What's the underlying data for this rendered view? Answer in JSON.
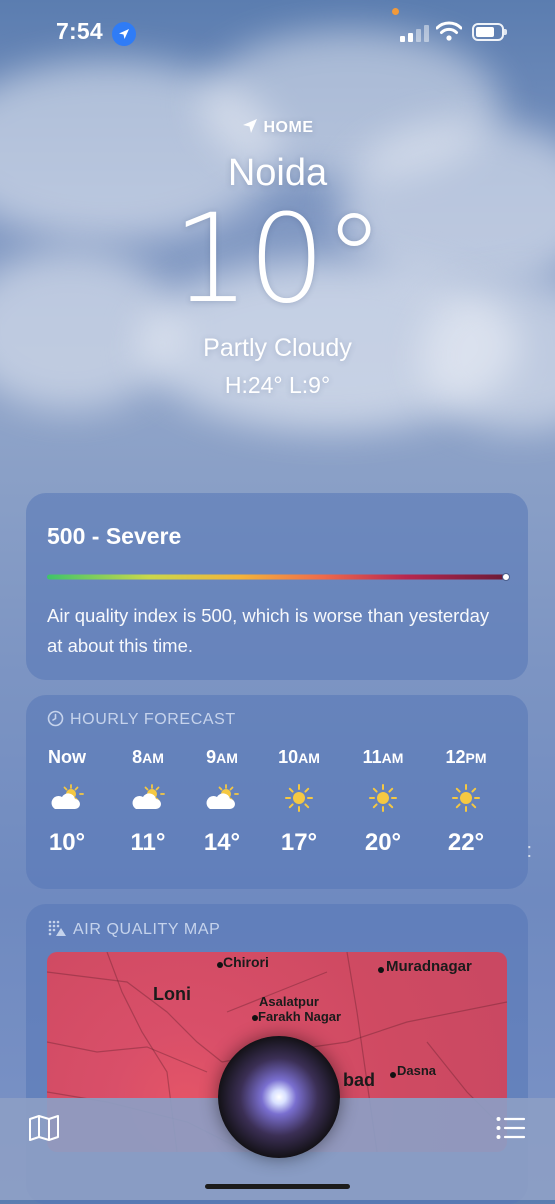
{
  "status_bar": {
    "time": "7:54"
  },
  "header": {
    "location_label": "HOME",
    "city": "Noida",
    "temperature": "10°",
    "condition": "Partly Cloudy",
    "high_low": "H:24°  L:9°"
  },
  "aqi": {
    "title": "500 - Severe",
    "level_fraction": 1.0,
    "description": "Air quality index is 500, which is worse than yesterday at about this time."
  },
  "hourly": {
    "heading": "HOURLY FORECAST",
    "hours": [
      {
        "label": "Now",
        "icon": "partly-cloudy-icon",
        "temp": "10°"
      },
      {
        "label": "8AM",
        "icon": "partly-cloudy-icon",
        "temp": "11°"
      },
      {
        "label": "9AM",
        "icon": "partly-cloudy-icon",
        "temp": "14°"
      },
      {
        "label": "10AM",
        "icon": "sun-icon",
        "temp": "17°"
      },
      {
        "label": "11AM",
        "icon": "sun-icon",
        "temp": "20°"
      },
      {
        "label": "12PM",
        "icon": "sun-icon",
        "temp": "22°"
      }
    ]
  },
  "air_quality_map": {
    "heading": "AIR QUALITY MAP",
    "places": [
      "Chirori",
      "Muradnagar",
      "Loni",
      "Asalatpur",
      "Farakh Nagar",
      "bad",
      "Dasna"
    ]
  },
  "colors": {
    "aqi_severe": "#7a1a3a",
    "map_red": "#d94f69",
    "accent_blue": "#2f7cf6"
  }
}
